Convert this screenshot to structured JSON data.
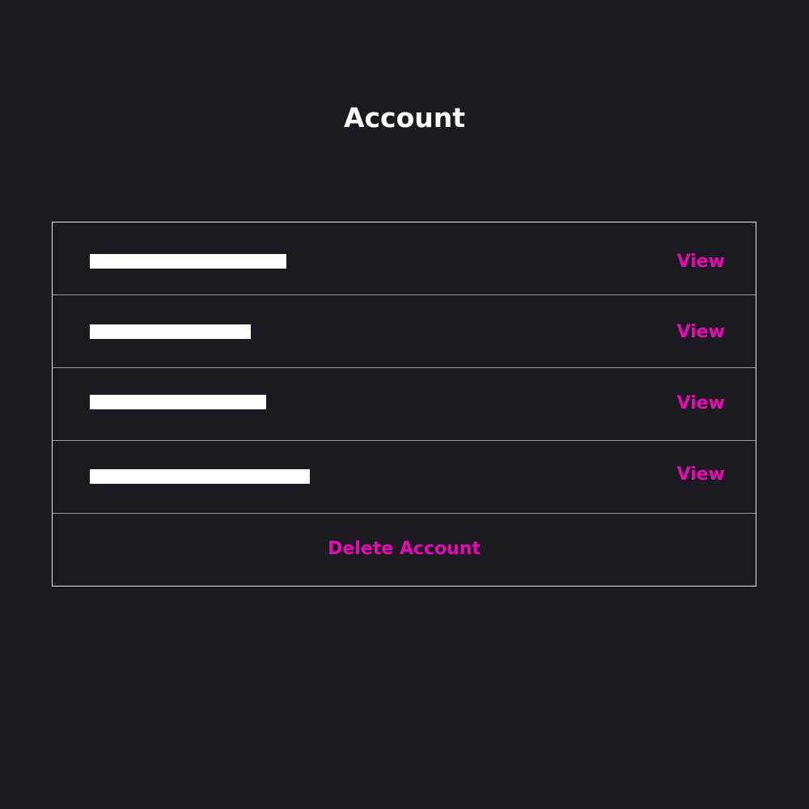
{
  "page": {
    "title": "Account"
  },
  "rows": [
    {
      "action_label": "View"
    },
    {
      "action_label": "View"
    },
    {
      "action_label": "View"
    },
    {
      "action_label": "View"
    }
  ],
  "delete": {
    "label": "Delete Account"
  },
  "colors": {
    "background": "#1a1a20",
    "accent": "#e60ab4",
    "text": "#ffffff"
  }
}
